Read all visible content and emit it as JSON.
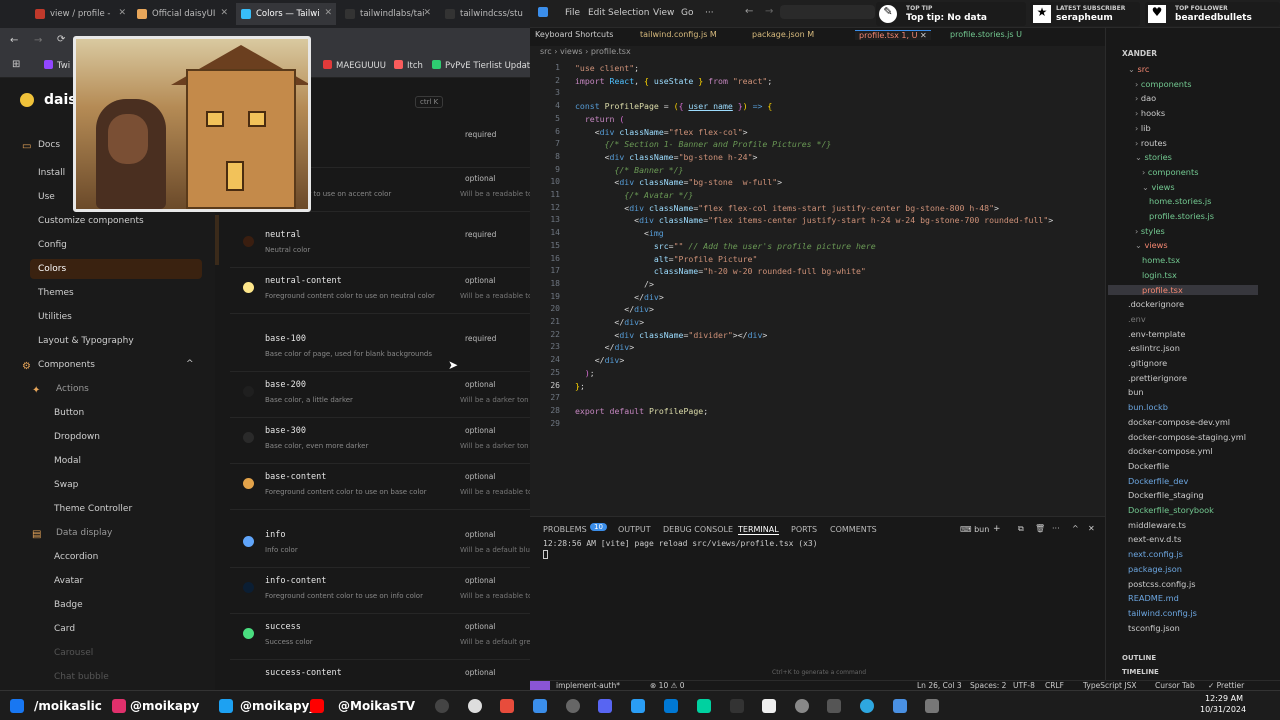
{
  "browser": {
    "tabs": [
      {
        "label": "view / profile -"
      },
      {
        "label": "Official daisyUI"
      },
      {
        "label": "Colors — Tailwi"
      },
      {
        "label": "tailwindlabs/tai"
      },
      {
        "label": "tailwindcss/stu"
      }
    ],
    "bookmarks": [
      {
        "label": "Twi"
      },
      {
        "label": "MAEGUUUU"
      },
      {
        "label": "Itch"
      },
      {
        "label": "PvPvE Tierlist Updat..."
      }
    ],
    "brand": "daisy",
    "search_shortcut": "ctrl K",
    "sidebar": [
      {
        "label": "Docs",
        "icon": "book-icon",
        "kind": "top"
      },
      {
        "label": "Install",
        "kind": "item"
      },
      {
        "label": "Use",
        "kind": "item"
      },
      {
        "label": "Customize components",
        "kind": "item"
      },
      {
        "label": "Config",
        "kind": "item"
      },
      {
        "label": "Colors",
        "kind": "active"
      },
      {
        "label": "Themes",
        "kind": "item"
      },
      {
        "label": "Utilities",
        "kind": "item"
      },
      {
        "label": "Layout & Typography",
        "kind": "item"
      },
      {
        "label": "Components",
        "icon": "components-icon",
        "kind": "top"
      },
      {
        "label": "Actions",
        "icon": "actions-icon",
        "kind": "section"
      },
      {
        "label": "Button",
        "kind": "sub"
      },
      {
        "label": "Dropdown",
        "kind": "sub"
      },
      {
        "label": "Modal",
        "kind": "sub"
      },
      {
        "label": "Swap",
        "kind": "sub"
      },
      {
        "label": "Theme Controller",
        "kind": "sub"
      },
      {
        "label": "Data display",
        "icon": "data-display-icon",
        "kind": "section"
      },
      {
        "label": "Accordion",
        "kind": "sub"
      },
      {
        "label": "Avatar",
        "kind": "sub"
      },
      {
        "label": "Badge",
        "kind": "sub"
      },
      {
        "label": "Card",
        "kind": "sub"
      },
      {
        "label": "Carousel",
        "kind": "sub"
      },
      {
        "label": "Chat bubble",
        "kind": "sub"
      }
    ],
    "colors": [
      {
        "name": "",
        "desc": "",
        "req": "required",
        "note": "",
        "dot": ""
      },
      {
        "name": "ontent",
        "desc": "content color to use on accent color",
        "req": "optional",
        "note": "Will be a readable to",
        "dot": ""
      },
      {
        "name": "neutral",
        "desc": "Neutral color",
        "req": "required",
        "note": "",
        "dot": "#3a1e10"
      },
      {
        "name": "neutral-content",
        "desc": "Foreground content color to use on neutral color",
        "req": "optional",
        "note": "Will be a readable to",
        "dot": "#fde68a"
      },
      {
        "name": "base-100",
        "desc": "Base color of page, used for blank backgrounds",
        "req": "required",
        "note": "",
        "dot": ""
      },
      {
        "name": "base-200",
        "desc": "Base color, a little darker",
        "req": "optional",
        "note": "Will be a darker ton",
        "dot": "#1f1f1f"
      },
      {
        "name": "base-300",
        "desc": "Base color, even more darker",
        "req": "optional",
        "note": "Will be a darker ton",
        "dot": "#2a2a2a"
      },
      {
        "name": "base-content",
        "desc": "Foreground content color to use on base color",
        "req": "optional",
        "note": "Will be a readable to",
        "dot": "#e3a34a"
      },
      {
        "name": "info",
        "desc": "Info color",
        "req": "optional",
        "note": "Will be a default blu",
        "dot": "#60a5fa"
      },
      {
        "name": "info-content",
        "desc": "Foreground content color to use on info color",
        "req": "optional",
        "note": "Will be a readable to",
        "dot": "#0b1e33"
      },
      {
        "name": "success",
        "desc": "Success color",
        "req": "optional",
        "note": "Will be a default gre",
        "dot": "#4ade80"
      },
      {
        "name": "success-content",
        "desc": "",
        "req": "optional",
        "note": "",
        "dot": ""
      }
    ]
  },
  "overlay": {
    "top_tip_label": "TOP TIP",
    "top_tip_value": "Top tip: No data",
    "subscriber_label": "LATEST SUBSCRIBER",
    "subscriber_value": "serapheum",
    "follower_label": "TOP FOLLOWER",
    "follower_value": "beardedbullets"
  },
  "vscode": {
    "menu": [
      "File",
      "Edit",
      "Selection",
      "View",
      "Go",
      "···"
    ],
    "tabs": [
      {
        "label": "Keyboard Shortcuts",
        "color": "#cccccc"
      },
      {
        "label": "tailwind.config.js M",
        "color": "#d7ba7d"
      },
      {
        "label": "package.json M",
        "color": "#d7ba7d"
      },
      {
        "label": "profile.tsx 1, U",
        "color": "#f48771"
      },
      {
        "label": "profile.stories.js U",
        "color": "#73c991"
      }
    ],
    "breadcrumb": "src › views › profile.tsx",
    "panel_tabs": [
      "PROBLEMS",
      "OUTPUT",
      "DEBUG CONSOLE",
      "TERMINAL",
      "PORTS",
      "COMMENTS"
    ],
    "problems_count": "10",
    "terminal_name": "bun",
    "terminal_line": "12:28:56 AM [vite] page reload src/views/profile.tsx (x3)",
    "cmd_hint": "Ctrl+K to generate a command",
    "explorer_root": "XANDER",
    "explorer": [
      {
        "label": "src",
        "color": "#f48771",
        "indent": 0,
        "arrow": "v"
      },
      {
        "label": "components",
        "color": "#73c991",
        "indent": 1,
        "arrow": ">"
      },
      {
        "label": "dao",
        "color": "#ccc",
        "indent": 1,
        "arrow": ">"
      },
      {
        "label": "hooks",
        "color": "#ccc",
        "indent": 1,
        "arrow": ">"
      },
      {
        "label": "lib",
        "color": "#ccc",
        "indent": 1,
        "arrow": ">"
      },
      {
        "label": "routes",
        "color": "#ccc",
        "indent": 1,
        "arrow": ">"
      },
      {
        "label": "stories",
        "color": "#73c991",
        "indent": 1,
        "arrow": "v"
      },
      {
        "label": "components",
        "color": "#73c991",
        "indent": 2,
        "arrow": ">"
      },
      {
        "label": "views",
        "color": "#73c991",
        "indent": 2,
        "arrow": "v"
      },
      {
        "label": "home.stories.js",
        "color": "#73c991",
        "indent": 3,
        "arrow": ""
      },
      {
        "label": "profile.stories.js",
        "color": "#73c991",
        "indent": 3,
        "arrow": ""
      },
      {
        "label": "styles",
        "color": "#73c991",
        "indent": 1,
        "arrow": ">"
      },
      {
        "label": "views",
        "color": "#f48771",
        "indent": 1,
        "arrow": "v"
      },
      {
        "label": "home.tsx",
        "color": "#73c991",
        "indent": 2,
        "arrow": ""
      },
      {
        "label": "login.tsx",
        "color": "#73c991",
        "indent": 2,
        "arrow": ""
      },
      {
        "label": "profile.tsx",
        "color": "#f48771",
        "indent": 2,
        "arrow": ""
      },
      {
        "label": ".dockerignore",
        "color": "#ccc",
        "indent": 0,
        "arrow": ""
      },
      {
        "label": ".env",
        "color": "#777",
        "indent": 0,
        "arrow": ""
      },
      {
        "label": ".env-template",
        "color": "#ccc",
        "indent": 0,
        "arrow": ""
      },
      {
        "label": ".eslintrc.json",
        "color": "#ccc",
        "indent": 0,
        "arrow": ""
      },
      {
        "label": ".gitignore",
        "color": "#ccc",
        "indent": 0,
        "arrow": ""
      },
      {
        "label": ".prettierignore",
        "color": "#ccc",
        "indent": 0,
        "arrow": ""
      },
      {
        "label": "bun",
        "color": "#ccc",
        "indent": 0,
        "arrow": ""
      },
      {
        "label": "bun.lockb",
        "color": "#6ca6e0",
        "indent": 0,
        "arrow": ""
      },
      {
        "label": "docker-compose-dev.yml",
        "color": "#ccc",
        "indent": 0,
        "arrow": ""
      },
      {
        "label": "docker-compose-staging.yml",
        "color": "#ccc",
        "indent": 0,
        "arrow": ""
      },
      {
        "label": "docker-compose.yml",
        "color": "#ccc",
        "indent": 0,
        "arrow": ""
      },
      {
        "label": "Dockerfile",
        "color": "#ccc",
        "indent": 0,
        "arrow": ""
      },
      {
        "label": "Dockerfile_dev",
        "color": "#6ca6e0",
        "indent": 0,
        "arrow": ""
      },
      {
        "label": "Dockerfile_staging",
        "color": "#ccc",
        "indent": 0,
        "arrow": ""
      },
      {
        "label": "Dockerfile_storybook",
        "color": "#73c991",
        "indent": 0,
        "arrow": ""
      },
      {
        "label": "middleware.ts",
        "color": "#ccc",
        "indent": 0,
        "arrow": ""
      },
      {
        "label": "next-env.d.ts",
        "color": "#ccc",
        "indent": 0,
        "arrow": ""
      },
      {
        "label": "next.config.js",
        "color": "#6ca6e0",
        "indent": 0,
        "arrow": ""
      },
      {
        "label": "package.json",
        "color": "#6ca6e0",
        "indent": 0,
        "arrow": ""
      },
      {
        "label": "postcss.config.js",
        "color": "#ccc",
        "indent": 0,
        "arrow": ""
      },
      {
        "label": "README.md",
        "color": "#6ca6e0",
        "indent": 0,
        "arrow": ""
      },
      {
        "label": "tailwind.config.js",
        "color": "#6ca6e0",
        "indent": 0,
        "arrow": ""
      },
      {
        "label": "tsconfig.json",
        "color": "#ccc",
        "indent": 0,
        "arrow": ""
      }
    ],
    "outline": "OUTLINE",
    "timeline": "TIMELINE",
    "status": {
      "branch": "implement-auth*",
      "errors": "⊗ 10 ⚠ 0",
      "warn": "⚠ 0",
      "pos": "Ln 26, Col 3",
      "spaces": "Spaces: 2",
      "enc": "UTF-8",
      "eol": "CRLF",
      "lang": "TypeScript JSX",
      "tab": "Cursor Tab",
      "fmt": "✓ Prettier"
    }
  },
  "taskbar": {
    "handles": [
      "/moikaslic",
      "@moikapy",
      "@moikapy_",
      "@MoikasTV"
    ],
    "time": "12:29 AM",
    "date": "10/31/2024"
  }
}
